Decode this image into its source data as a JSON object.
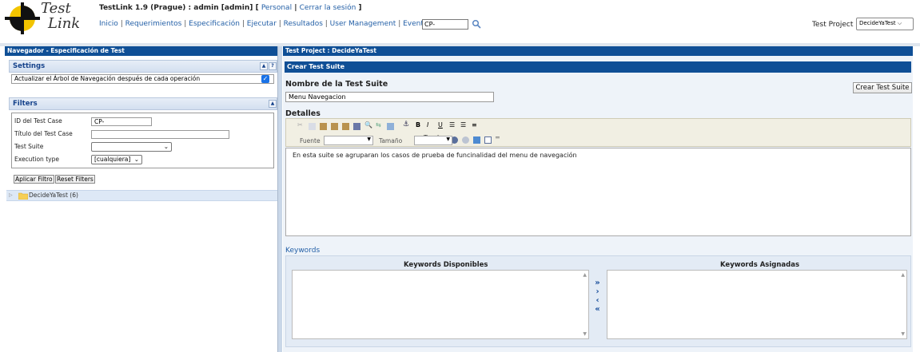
{
  "header": {
    "title": "TestLink 1.9 (Prague) : admin [admin]",
    "personal_link": "Personal",
    "logout_link": "Cerrar la sesión",
    "nav": [
      "Inicio",
      "Requerimientos",
      "Especificación",
      "Ejecutar",
      "Resultados",
      "User Management",
      "Events"
    ],
    "search_value": "CP-",
    "test_project_label": "Test Project",
    "test_project_value": "DecideYaTest",
    "logo_text_top": "Test",
    "logo_text_bottom": "Link"
  },
  "left": {
    "panel_title": "Navegador - Especificación de Test",
    "settings": {
      "title": "Settings",
      "option_label": "Actualizar el Árbol de Navegación después de cada operación",
      "option_checked": true
    },
    "filters": {
      "title": "Filters",
      "id_label": "ID del Test Case",
      "id_value": "CP-",
      "titulo_label": "Título del Test Case",
      "titulo_value": "",
      "suite_label": "Test Suite",
      "suite_value": "",
      "exec_label": "Execution type",
      "exec_value": "[cualquiera]",
      "apply_label": "Aplicar Filtro",
      "reset_label": "Reset Filters"
    },
    "tree": {
      "root_label": "DecideYaTest (6)"
    }
  },
  "right": {
    "panel_title": "Test Project : DecideYaTest",
    "section_title": "Crear Test Suite",
    "nombre_label": "Nombre de la Test Suite",
    "nombre_value": "Menu Navegacion",
    "crear_button": "Crear Test Suite",
    "detalles_label": "Detalles",
    "fuente_label": "Fuente",
    "tamano_label": "Tamaño",
    "detalles_text": "En esta suite se agruparan los casos de prueba de funcinalidad del menu de navegación",
    "keywords_label": "Keywords",
    "kw_disponibles": "Keywords Disponibles",
    "kw_asignadas": "Keywords Asignadas"
  },
  "colors": {
    "panel_bar": "#0f4f96",
    "link": "#2460a7",
    "section_bg": "#eef3f9"
  }
}
